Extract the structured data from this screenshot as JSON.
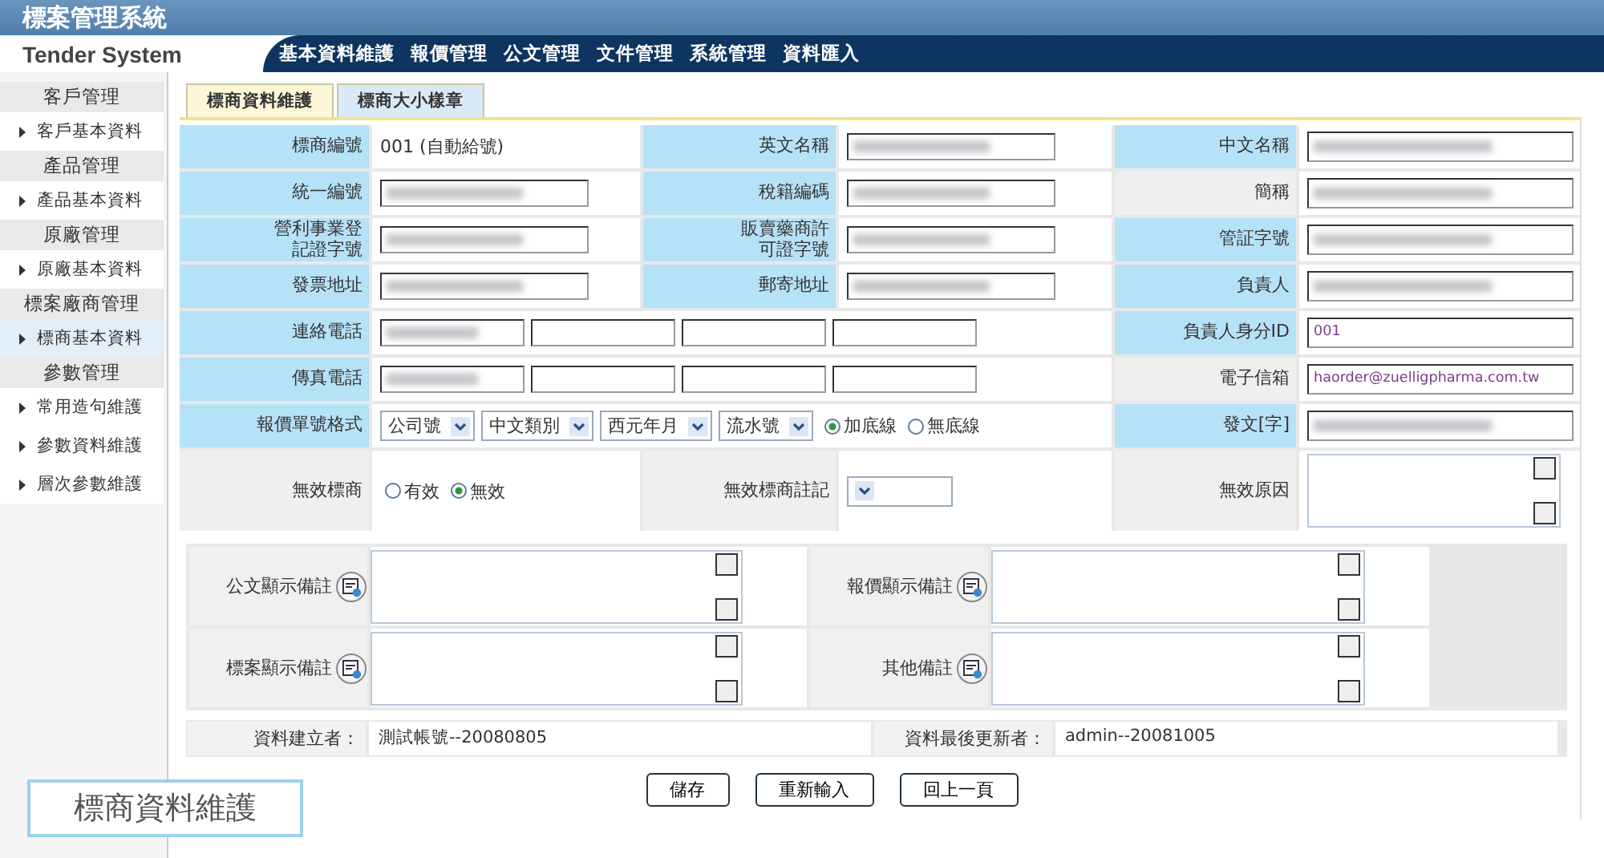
{
  "app": {
    "title": "標案管理系統",
    "subtitle": "Tender System"
  },
  "menu": [
    "基本資料維護",
    "報價管理",
    "公文管理",
    "文件管理",
    "系統管理",
    "資料匯入"
  ],
  "sidebar": [
    {
      "kind": "header",
      "label": "客戶管理"
    },
    {
      "kind": "item",
      "label": "客戶基本資料",
      "selected": false
    },
    {
      "kind": "header",
      "label": "產品管理"
    },
    {
      "kind": "item",
      "label": "產品基本資料",
      "selected": false
    },
    {
      "kind": "header",
      "label": "原廠管理"
    },
    {
      "kind": "item",
      "label": "原廠基本資料",
      "selected": false
    },
    {
      "kind": "header",
      "label": "標案廠商管理"
    },
    {
      "kind": "item",
      "label": "標商基本資料",
      "selected": true
    },
    {
      "kind": "header",
      "label": "參數管理"
    },
    {
      "kind": "item",
      "label": "常用造句維護",
      "selected": false
    },
    {
      "kind": "item",
      "label": "參數資料維護",
      "selected": false
    },
    {
      "kind": "item",
      "label": "層次參數維護",
      "selected": false
    }
  ],
  "tabs": [
    {
      "label": "標商資料維護",
      "selected": true
    },
    {
      "label": "標商大小樣章",
      "selected": false
    }
  ],
  "form": [
    [
      {
        "kind": "label",
        "text": "標商編號",
        "required": true
      },
      {
        "kind": "text",
        "text": "001 (自動給號)"
      },
      {
        "kind": "label",
        "text": "英文名稱",
        "required": true
      },
      {
        "kind": "input",
        "blurred": true
      },
      {
        "kind": "label",
        "text": "中文名稱",
        "required": true
      },
      {
        "kind": "input",
        "blurred": true
      }
    ],
    [
      {
        "kind": "label",
        "text": "統一編號",
        "required": true
      },
      {
        "kind": "input",
        "blurred": true
      },
      {
        "kind": "label",
        "text": "稅籍編碼",
        "required": true
      },
      {
        "kind": "input",
        "blurred": true
      },
      {
        "kind": "label",
        "text": "簡稱",
        "required": false
      },
      {
        "kind": "input",
        "blurred": true
      }
    ],
    [
      {
        "kind": "label",
        "text": "營利事業登記證字號",
        "required": true
      },
      {
        "kind": "input",
        "blurred": true
      },
      {
        "kind": "label",
        "text": "販賣藥商許可證字號",
        "required": true
      },
      {
        "kind": "input",
        "blurred": true
      },
      {
        "kind": "label",
        "text": "管証字號",
        "required": true
      },
      {
        "kind": "input",
        "blurred": true
      }
    ],
    [
      {
        "kind": "label",
        "text": "發票地址",
        "required": true
      },
      {
        "kind": "input",
        "blurred": true
      },
      {
        "kind": "label",
        "text": "郵寄地址",
        "required": true
      },
      {
        "kind": "input",
        "blurred": true
      },
      {
        "kind": "label",
        "text": "負責人",
        "required": true
      },
      {
        "kind": "input",
        "blurred": true
      }
    ],
    [
      {
        "kind": "label",
        "text": "連絡電話",
        "required": true
      },
      {
        "kind": "phones",
        "fields": [
          {
            "blurred": true
          },
          {
            "blurred": false
          },
          {
            "blurred": false
          },
          {
            "blurred": false
          }
        ]
      },
      {
        "kind": "label",
        "text": "負責人身分ID",
        "required": true
      },
      {
        "kind": "input",
        "value": "001"
      }
    ],
    [
      {
        "kind": "label",
        "text": "傳真電話",
        "required": true
      },
      {
        "kind": "phones",
        "fields": [
          {
            "blurred": true
          },
          {
            "blurred": false
          },
          {
            "blurred": false
          },
          {
            "blurred": false
          }
        ]
      },
      {
        "kind": "label",
        "text": "電子信箱",
        "required": false
      },
      {
        "kind": "input",
        "value": "haorder@zuelligpharma.com.tw"
      }
    ],
    [
      {
        "kind": "label",
        "text": "報價單號格式",
        "required": true
      },
      {
        "kind": "format",
        "selects": [
          "公司號",
          "中文類別",
          "西元年月",
          "流水號"
        ],
        "radios": [
          {
            "label": "加底線",
            "selected": true
          },
          {
            "label": "無底線",
            "selected": false
          }
        ]
      },
      {
        "kind": "label",
        "text": "發文[字]",
        "required": true
      },
      {
        "kind": "input",
        "blurred": true
      }
    ],
    [
      {
        "kind": "label",
        "text": "無效標商",
        "required": false
      },
      {
        "kind": "radios",
        "radios": [
          {
            "label": "有效",
            "selected": false
          },
          {
            "label": "無效",
            "selected": true
          }
        ]
      },
      {
        "kind": "label",
        "text": "無效標商註記",
        "required": false
      },
      {
        "kind": "select"
      },
      {
        "kind": "label",
        "text": "無效原因",
        "required": false
      },
      {
        "kind": "textarea"
      }
    ]
  ],
  "remarks": [
    "公文顯示備註",
    "報價顯示備註",
    "標案顯示備註",
    "其他備註"
  ],
  "audit": [
    {
      "label": "資料建立者：",
      "value": "測試帳號--20080805"
    },
    {
      "label": "資料最後更新者：",
      "value": "admin--20081005"
    }
  ],
  "buttons": [
    "儲存",
    "重新輸入",
    "回上一頁"
  ],
  "caption": "標商資料維護"
}
